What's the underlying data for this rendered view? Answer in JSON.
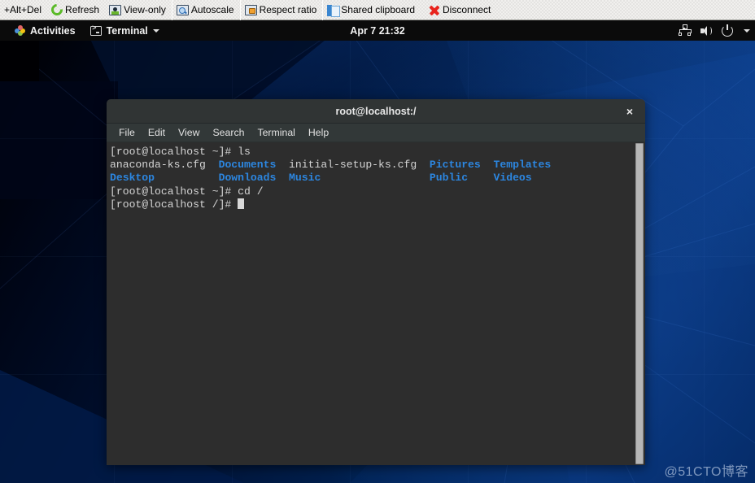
{
  "vnc_toolbar": {
    "buttons": [
      {
        "label": "+Alt+Del",
        "icon": "keyboard-icon",
        "has_icon": false
      },
      {
        "label": "Refresh",
        "icon": "refresh-icon",
        "has_icon": true
      },
      {
        "label": "View-only",
        "icon": "view-only-monitor-icon",
        "has_icon": true
      },
      {
        "label": "Autoscale",
        "icon": "autoscale-magnifier-icon",
        "has_icon": true
      },
      {
        "label": "Respect ratio",
        "icon": "respect-ratio-lock-icon",
        "has_icon": true
      },
      {
        "label": "Shared clipboard",
        "icon": "clipboard-icon",
        "has_icon": true
      },
      {
        "label": "Disconnect",
        "icon": "disconnect-x-icon",
        "has_icon": true
      }
    ]
  },
  "gnome_bar": {
    "activities_label": "Activities",
    "app_menu_label": "Terminal",
    "clock": "Apr 7  21:32",
    "status_icons": [
      "network-wired-icon",
      "volume-icon",
      "power-icon",
      "chevron-down-icon"
    ]
  },
  "terminal_window": {
    "title": "root@localhost:/",
    "close_label": "×",
    "menus": [
      "File",
      "Edit",
      "View",
      "Search",
      "Terminal",
      "Help"
    ],
    "lines": [
      {
        "segments": [
          {
            "text": "[root@localhost ~]# ls",
            "style": "default"
          }
        ]
      },
      {
        "segments": [
          {
            "text": "anaconda-ks.cfg",
            "style": "default"
          },
          {
            "text": "  ",
            "style": "default"
          },
          {
            "text": "Documents",
            "style": "directory"
          },
          {
            "text": "  ",
            "style": "default"
          },
          {
            "text": "initial-setup-ks.cfg",
            "style": "default"
          },
          {
            "text": "  ",
            "style": "default"
          },
          {
            "text": "Pictures",
            "style": "directory"
          },
          {
            "text": "  ",
            "style": "default"
          },
          {
            "text": "Templates",
            "style": "directory"
          }
        ]
      },
      {
        "segments": [
          {
            "text": "Desktop",
            "style": "directory"
          },
          {
            "text": "          ",
            "style": "default"
          },
          {
            "text": "Downloads",
            "style": "directory"
          },
          {
            "text": "  ",
            "style": "default"
          },
          {
            "text": "Music",
            "style": "directory"
          },
          {
            "text": "                 ",
            "style": "default"
          },
          {
            "text": "Public",
            "style": "directory"
          },
          {
            "text": "    ",
            "style": "default"
          },
          {
            "text": "Videos",
            "style": "directory"
          }
        ]
      },
      {
        "segments": [
          {
            "text": "[root@localhost ~]# cd /",
            "style": "default"
          }
        ]
      },
      {
        "segments": [
          {
            "text": "[root@localhost /]# ",
            "style": "default"
          },
          {
            "text": "",
            "style": "cursor"
          }
        ]
      }
    ]
  },
  "watermark": {
    "text": "@51CTO博客"
  },
  "colors": {
    "terminal_bg": "#2d2d2d",
    "titlebar_bg": "#303434",
    "menubar_bg": "#323838",
    "directory_blue": "#2c86e0",
    "text_gray": "#d4d4d4",
    "gnome_bar_bg": "#0b0b0b",
    "toolbar_bg": "#f1f0ee",
    "disconnect_red": "#e8231c",
    "refresh_green": "#5aba27",
    "wallpaper_blue": "#00204f"
  }
}
